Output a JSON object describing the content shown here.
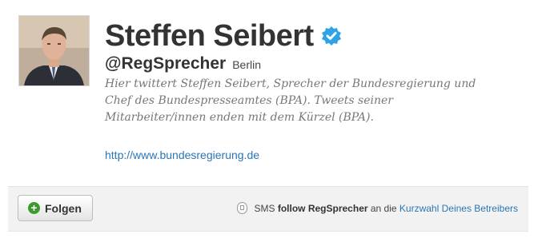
{
  "profile": {
    "name": "Steffen Seibert",
    "handle": "@RegSprecher",
    "location": "Berlin",
    "bio": "Hier twittert Steffen Seibert, Sprecher der Bundesregierung und Chef des Bundespresseamtes (BPA). Tweets seiner Mitarbeiter/innen enden mit dem Kürzel (BPA).",
    "url": "http://www.bundesregierung.de",
    "verified_icon": "verified-badge-icon"
  },
  "actions": {
    "follow_label": "Folgen",
    "sms_prefix": "SMS",
    "sms_command": "follow RegSprecher",
    "sms_middle": "an die",
    "sms_link": "Kurzwahl Deines Betreibers"
  },
  "colors": {
    "link": "#2a76b6",
    "verified": "#2fa3e8",
    "follow_plus": "#3a9b2d",
    "bar_background": "#f2f2f2"
  }
}
